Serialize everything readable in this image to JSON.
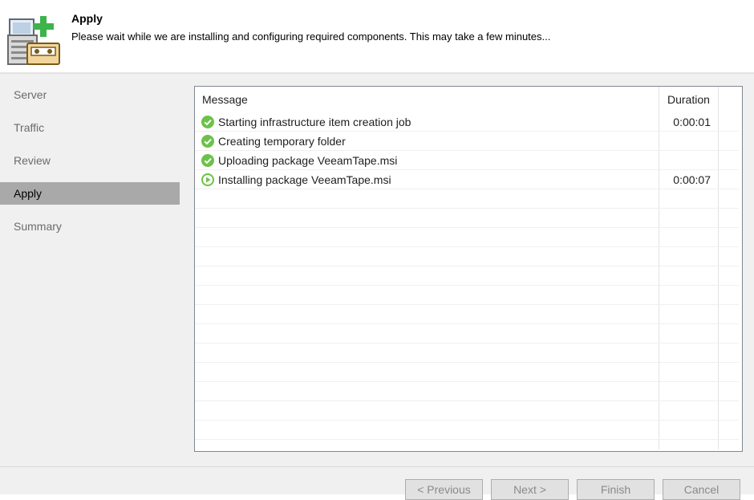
{
  "header": {
    "title": "Apply",
    "subtitle": "Please wait while we are installing and configuring required components. This may take a few minutes...",
    "icon": "tape-server-add-icon"
  },
  "sidebar": {
    "items": [
      {
        "label": "Server"
      },
      {
        "label": "Traffic"
      },
      {
        "label": "Review"
      },
      {
        "label": "Apply",
        "active": true
      },
      {
        "label": "Summary"
      }
    ]
  },
  "grid": {
    "columns": {
      "message": "Message",
      "duration": "Duration"
    },
    "rows": [
      {
        "status": "success",
        "icon": "check-circle-icon",
        "message": "Starting infrastructure item creation job",
        "duration": "0:00:01"
      },
      {
        "status": "success",
        "icon": "check-circle-icon",
        "message": "Creating temporary folder",
        "duration": ""
      },
      {
        "status": "success",
        "icon": "check-circle-icon",
        "message": "Uploading package VeeamTape.msi",
        "duration": ""
      },
      {
        "status": "running",
        "icon": "play-circle-icon",
        "message": "Installing package VeeamTape.msi",
        "duration": "0:00:07"
      }
    ]
  },
  "footer": {
    "previous_label": "< Previous",
    "next_label": "Next >",
    "finish_label": "Finish",
    "cancel_label": "Cancel"
  },
  "colors": {
    "success": "#6cc24a",
    "accent_green": "#3cb44b",
    "selected_nav": "#a9a9a9"
  }
}
